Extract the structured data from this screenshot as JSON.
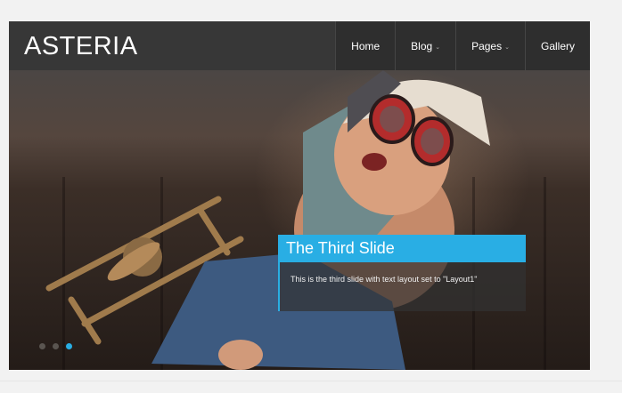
{
  "site": {
    "logo": "ASTERIA"
  },
  "nav": {
    "items": [
      {
        "label": "Home",
        "has_dropdown": false
      },
      {
        "label": "Blog",
        "has_dropdown": true
      },
      {
        "label": "Pages",
        "has_dropdown": true
      },
      {
        "label": "Gallery",
        "has_dropdown": false
      }
    ]
  },
  "slider": {
    "caption_title": "The Third Slide",
    "caption_text": "This is the third slide with text layout set to \"Layout1\"",
    "slide_count": 3,
    "active_slide": 3
  },
  "colors": {
    "accent": "#29aee4",
    "header_bg": "#373737",
    "nav_bg": "#2e2e2e",
    "page_bg": "#f2f2f2"
  }
}
